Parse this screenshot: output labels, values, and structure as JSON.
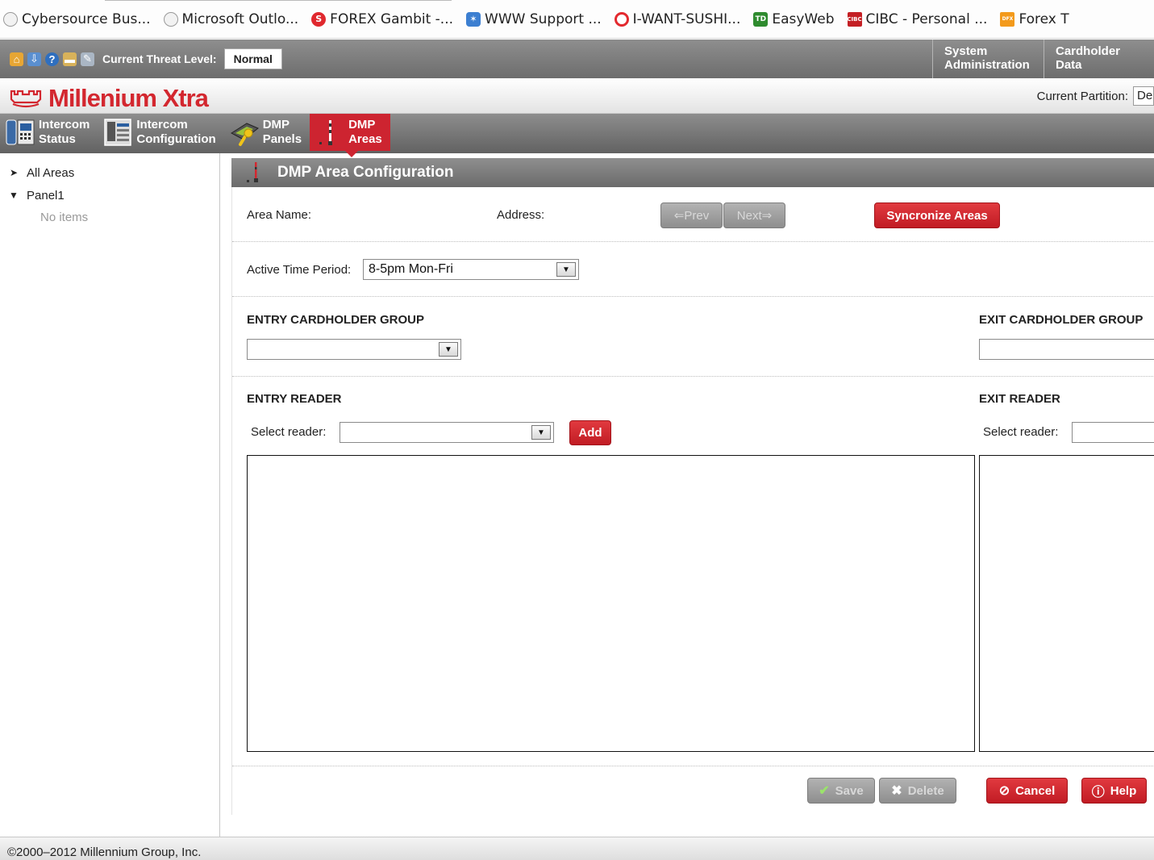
{
  "browser": {
    "bookmarks": [
      {
        "label": "Cybersource Bus...",
        "icon": "globe-icon"
      },
      {
        "label": "Microsoft Outlo...",
        "icon": "globe-icon"
      },
      {
        "label": "FOREX Gambit -...",
        "icon": "forex-gambit-icon"
      },
      {
        "label": "WWW Support ...",
        "icon": "support-icon"
      },
      {
        "label": "I-WANT-SUSHI...",
        "icon": "sushi-icon"
      },
      {
        "label": "EasyWeb",
        "icon": "td-icon"
      },
      {
        "label": "CIBC - Personal ...",
        "icon": "cibc-icon"
      },
      {
        "label": "Forex T",
        "icon": "dfx-icon"
      }
    ]
  },
  "topbar": {
    "threat_label": "Current Threat Level:",
    "threat_value": "Normal",
    "nav": [
      "System Administration",
      "Cardholder Data"
    ]
  },
  "logo": {
    "text": "Millenium Xtra"
  },
  "partition": {
    "label": "Current Partition:",
    "value": "De"
  },
  "module_tabs": [
    {
      "line1": "Intercom",
      "line2": "Status",
      "active": false
    },
    {
      "line1": "Intercom",
      "line2": "Configuration",
      "active": false
    },
    {
      "line1": "DMP",
      "line2": "Panels",
      "active": false
    },
    {
      "line1": "DMP",
      "line2": "Areas",
      "active": true
    }
  ],
  "sidebar": {
    "items": [
      {
        "label": "All Areas",
        "expanded": false
      },
      {
        "label": "Panel1",
        "expanded": true
      }
    ],
    "empty_text": "No items"
  },
  "panel": {
    "title": "DMP Area Configuration",
    "area_name_label": "Area Name:",
    "address_label": "Address:",
    "prev_label": "⇐Prev",
    "next_label": "Next⇒",
    "sync_label": "Syncronize Areas",
    "active_time_label": "Active Time Period:",
    "active_time_value": "8-5pm Mon-Fri",
    "entry_group_heading": "ENTRY CARDHOLDER GROUP",
    "exit_group_heading": "EXIT CARDHOLDER GROUP",
    "entry_reader_heading": "ENTRY READER",
    "exit_reader_heading": "EXIT READER",
    "select_reader_label": "Select reader:",
    "add_label": "Add",
    "save_label": "Save",
    "delete_label": "Delete",
    "cancel_label": "Cancel",
    "help_label": "Help"
  },
  "footer": {
    "copyright": "©2000–2012 Millennium Group, Inc."
  },
  "colors": {
    "accent": "#cd2430",
    "bar_gray": "#7a7a7a"
  }
}
